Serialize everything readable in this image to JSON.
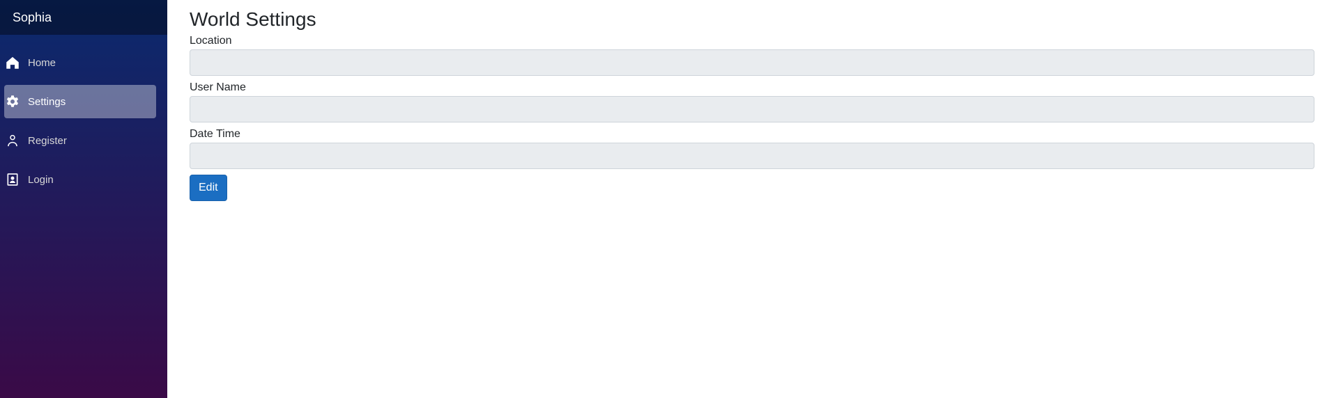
{
  "app": {
    "brand": "Sophia"
  },
  "sidebar": {
    "items": [
      {
        "label": "Home",
        "icon": "home-icon",
        "active": false
      },
      {
        "label": "Settings",
        "icon": "gear-icon",
        "active": true
      },
      {
        "label": "Register",
        "icon": "person-icon",
        "active": false
      },
      {
        "label": "Login",
        "icon": "badge-icon",
        "active": false
      }
    ]
  },
  "main": {
    "title": "World Settings",
    "fields": [
      {
        "label": "Location",
        "value": ""
      },
      {
        "label": "User Name",
        "value": ""
      },
      {
        "label": "Date Time",
        "value": ""
      }
    ],
    "edit_label": "Edit"
  },
  "colors": {
    "sidebar_top": "#0a2a6e",
    "sidebar_bottom": "#3a0a47",
    "button_primary": "#1b6ec2",
    "input_bg": "#e9ecef"
  }
}
